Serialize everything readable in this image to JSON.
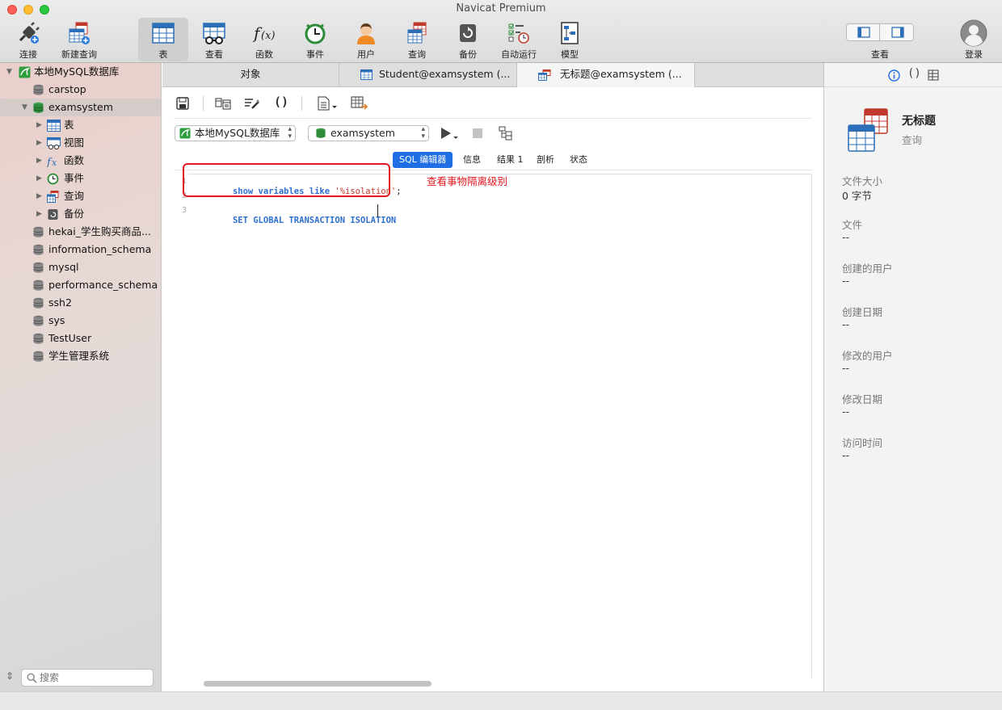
{
  "window": {
    "title": "Navicat Premium"
  },
  "toolbar": {
    "items": [
      {
        "label": "连接",
        "icon": "connect-plug-icon"
      },
      {
        "label": "新建查询",
        "icon": "new-query-icon"
      },
      {
        "label": "表",
        "icon": "table-icon"
      },
      {
        "label": "查看",
        "icon": "view-icon"
      },
      {
        "label": "函数",
        "icon": "function-icon"
      },
      {
        "label": "事件",
        "icon": "event-clock-icon"
      },
      {
        "label": "用户",
        "icon": "user-icon"
      },
      {
        "label": "查询",
        "icon": "query-icon"
      },
      {
        "label": "备份",
        "icon": "backup-icon"
      },
      {
        "label": "自动运行",
        "icon": "autorun-icon"
      },
      {
        "label": "模型",
        "icon": "model-icon"
      }
    ],
    "view_label": "查看",
    "login_label": "登录"
  },
  "sidebar": {
    "connection": "本地MySQL数据库",
    "databases": [
      "carstop",
      "examsystem"
    ],
    "examsystem_children": [
      {
        "label": "表",
        "icon": "table-icon"
      },
      {
        "label": "视图",
        "icon": "view-icon"
      },
      {
        "label": "函数",
        "icon": "function-icon"
      },
      {
        "label": "事件",
        "icon": "event-clock-icon"
      },
      {
        "label": "查询",
        "icon": "query-icon"
      },
      {
        "label": "备份",
        "icon": "backup-icon"
      }
    ],
    "other_databases": [
      "hekai_学生购买商品...",
      "information_schema",
      "mysql",
      "performance_schema",
      "ssh2",
      "sys",
      "TestUser",
      "学生管理系统"
    ],
    "search_placeholder": "搜索"
  },
  "tabs": [
    {
      "label": "对象"
    },
    {
      "label": "Student@examsystem (..."
    },
    {
      "label": "无标题@examsystem (..."
    }
  ],
  "editor": {
    "connection_select": "本地MySQL数据库",
    "database_select": "examsystem",
    "subtabs": [
      "SQL 编辑器",
      "信息",
      "结果 1",
      "剖析",
      "状态"
    ],
    "lines": [
      {
        "num": "1",
        "code": [
          {
            "t": "show variables like ",
            "c": "kw"
          },
          {
            "t": "'%isolation'",
            "c": "str"
          },
          {
            "t": ";",
            "c": "plain"
          }
        ]
      },
      {
        "num": "2",
        "code": []
      },
      {
        "num": "3",
        "code": [
          {
            "t": "SET GLOBAL TRANSACTION ISOLATION ",
            "c": "kw"
          }
        ]
      }
    ],
    "annotation": "查看事物隔离级别"
  },
  "info_panel": {
    "title": "无标题",
    "subtitle": "查询",
    "props": [
      {
        "label": "文件大小",
        "value": "0 字节"
      },
      {
        "label": "文件",
        "value": "--"
      },
      {
        "label": "创建的用户",
        "value": "--"
      },
      {
        "label": "创建日期",
        "value": "--"
      },
      {
        "label": "修改的用户",
        "value": "--"
      },
      {
        "label": "修改日期",
        "value": "--"
      },
      {
        "label": "访问时间",
        "value": "--"
      }
    ]
  }
}
